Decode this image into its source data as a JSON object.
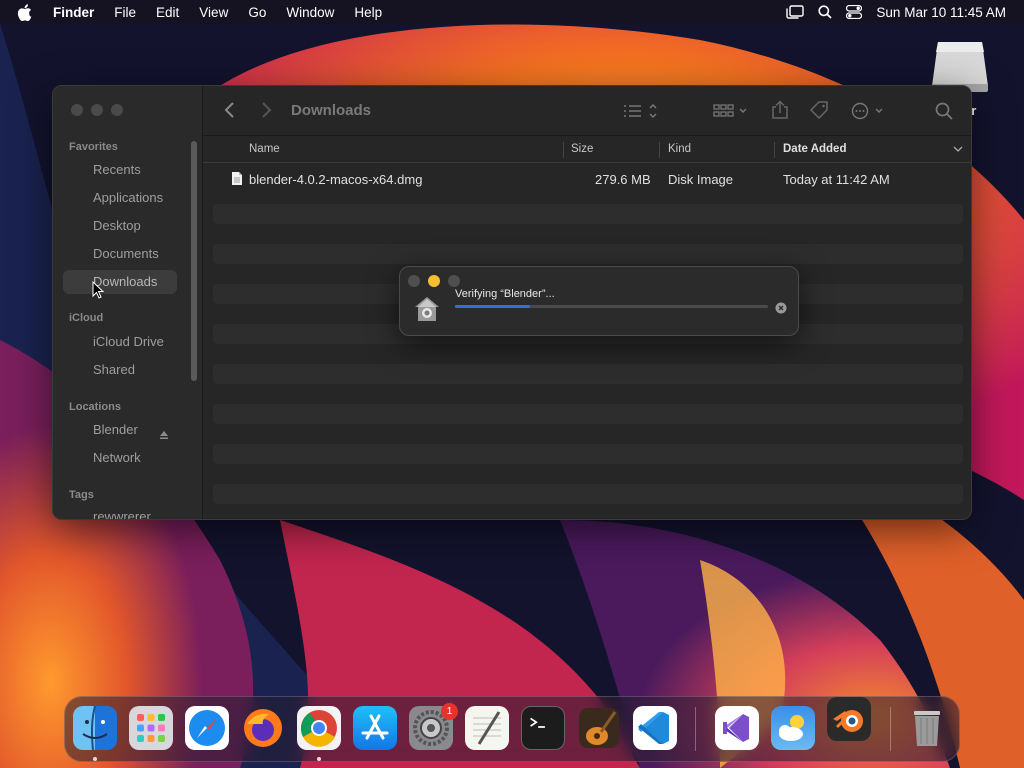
{
  "menubar": {
    "app_name": "Finder",
    "menus": [
      "File",
      "Edit",
      "View",
      "Go",
      "Window",
      "Help"
    ],
    "clock": "Sun Mar 10  11:45 AM",
    "icons": [
      "stage-manager-icon",
      "search-icon",
      "control-center-icon"
    ]
  },
  "desktop": {
    "drive_label": "er"
  },
  "finder": {
    "folder_title": "Downloads",
    "sidebar": {
      "favorites_title": "Favorites",
      "favorites": [
        "Recents",
        "Applications",
        "Desktop",
        "Documents",
        "Downloads"
      ],
      "icloud_title": "iCloud",
      "icloud": [
        "iCloud Drive",
        "Shared"
      ],
      "locations_title": "Locations",
      "locations": [
        "Blender",
        "Network"
      ],
      "tags_title": "Tags",
      "tags": [
        "rewwrerer"
      ],
      "selected": "Downloads"
    },
    "columns": {
      "name": "Name",
      "size": "Size",
      "kind": "Kind",
      "date_added": "Date Added"
    },
    "files": [
      {
        "name": "blender-4.0.2-macos-x64.dmg",
        "size": "279.6 MB",
        "kind": "Disk Image",
        "date_added": "Today at 11:42 AM"
      }
    ]
  },
  "dialog": {
    "message": "Verifying “Blender”...",
    "progress": 0.24,
    "accent": "#2f6fe0"
  },
  "dock": {
    "apps": [
      "Finder",
      "Launchpad",
      "Safari",
      "Firefox",
      "Chrome",
      "App Store",
      "System Settings",
      "TextEdit",
      "Terminal",
      "GarageBand",
      "Visual Studio Code",
      "Visual Studio",
      "Weather",
      "Blender",
      "Trash"
    ],
    "settings_badge": "1"
  }
}
